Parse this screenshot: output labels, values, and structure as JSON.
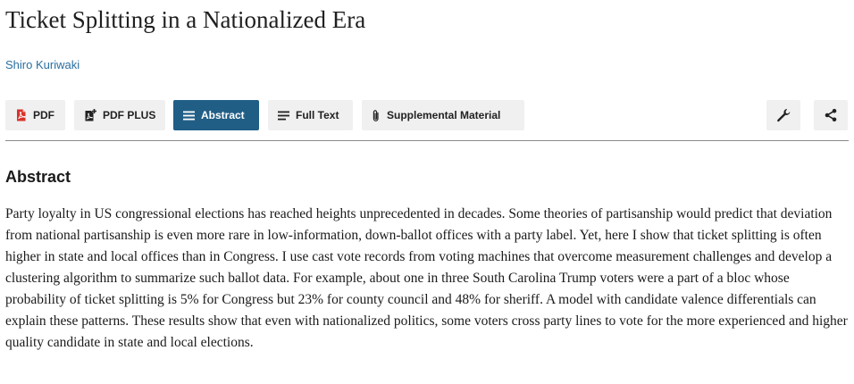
{
  "article": {
    "title": "Ticket Splitting in a Nationalized Era",
    "author": "Shiro Kuriwaki"
  },
  "toolbar": {
    "buttons": [
      {
        "label": "PDF",
        "icon": "pdf-icon",
        "active": false
      },
      {
        "label": "PDF PLUS",
        "icon": "pdf-plus-icon",
        "active": false
      },
      {
        "label": "Abstract",
        "icon": "list-icon",
        "active": true
      },
      {
        "label": "Full Text",
        "icon": "list-icon",
        "active": false
      },
      {
        "label": "Supplemental Material",
        "icon": "paperclip-icon",
        "active": false
      }
    ],
    "tools_icon": "wrench-icon",
    "share_icon": "share-icon"
  },
  "abstract": {
    "heading": "Abstract",
    "text": "Party loyalty in US congressional elections has reached heights unprecedented in decades. Some theories of partisanship would predict that deviation from national partisanship is even more rare in low-information, down-ballot offices with a party label. Yet, here I show that ticket splitting is often higher in state and local offices than in Congress. I use cast vote records from voting machines that overcome measurement challenges and develop a clustering algorithm to summarize such ballot data. For example, about one in three South Carolina Trump voters were a part of a bloc whose probability of ticket splitting is 5% for Congress but 23% for county council and 48% for sheriff. A model with candidate valence differentials can explain these patterns. These results show that even with nationalized politics, some voters cross party lines to vote for the more experienced and higher quality candidate in state and local elections."
  },
  "colors": {
    "accent": "#205e86",
    "link": "#2a6fa0",
    "pdf_red": "#d8322a",
    "button_bg": "#f0f0f0"
  }
}
